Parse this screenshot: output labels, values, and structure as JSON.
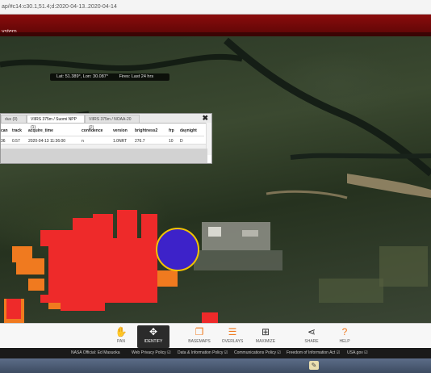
{
  "browser": {
    "url": "ap/#c14:c30.1,51.4;d:2020-04-13..2020-04-14"
  },
  "app": {
    "header_text": "ystem"
  },
  "map": {
    "coords_lat": "Lat: 51.389°, Lon: 30.087°",
    "coords_fires": "Fires: Last 24 hrs",
    "fire_color": "#ee2a2a",
    "fire_edge_color": "#f07a1f",
    "selected_pixel_color": "#3d22c9"
  },
  "panel": {
    "tabs": [
      {
        "label": "dus (0)"
      },
      {
        "label": "VIIRS 375m / Suomi NPP (1)"
      },
      {
        "label": "VIIRS 375m / NOAA-20 (0)"
      }
    ],
    "close": "✖",
    "columns": [
      "can",
      "track",
      "acquire_time",
      "confidence",
      "version",
      "brightness2",
      "frp",
      "daynight"
    ],
    "rows": [
      [
        "36",
        "0.57",
        "2020-04-13 11:36:00",
        "n",
        "1.0NRT",
        "276.7",
        "10",
        "D"
      ]
    ]
  },
  "toolbar": {
    "items": [
      {
        "label": "PAN",
        "icon": "hand-icon",
        "glyph": "✋",
        "color": "#f07a1f",
        "active": false
      },
      {
        "label": "IDENTIFY",
        "icon": "identify-icon",
        "glyph": "✥",
        "color": "#f07a1f",
        "active": true
      },
      {
        "label": "BASEMAPS",
        "icon": "basemaps-icon",
        "glyph": "❐",
        "color": "#f07a1f",
        "active": false
      },
      {
        "label": "OVERLAYS",
        "icon": "overlays-icon",
        "glyph": "☰",
        "color": "#f07a1f",
        "active": false
      },
      {
        "label": "MAXIMIZE",
        "icon": "maximize-icon",
        "glyph": "⊞",
        "color": "#333333",
        "active": false
      },
      {
        "label": "SHARE",
        "icon": "share-icon",
        "glyph": "⋖",
        "color": "#333333",
        "active": false
      },
      {
        "label": "HELP",
        "icon": "help-icon",
        "glyph": "?",
        "color": "#f07a1f",
        "active": false
      }
    ]
  },
  "footer": {
    "official": "NASA Official: Ed Masuoka",
    "links": [
      "Web Privacy Policy ☑",
      "Data & Information Policy ☑",
      "Communications Policy ☑",
      "Freedom of Information Act ☑",
      "USA.gov ☑"
    ]
  }
}
